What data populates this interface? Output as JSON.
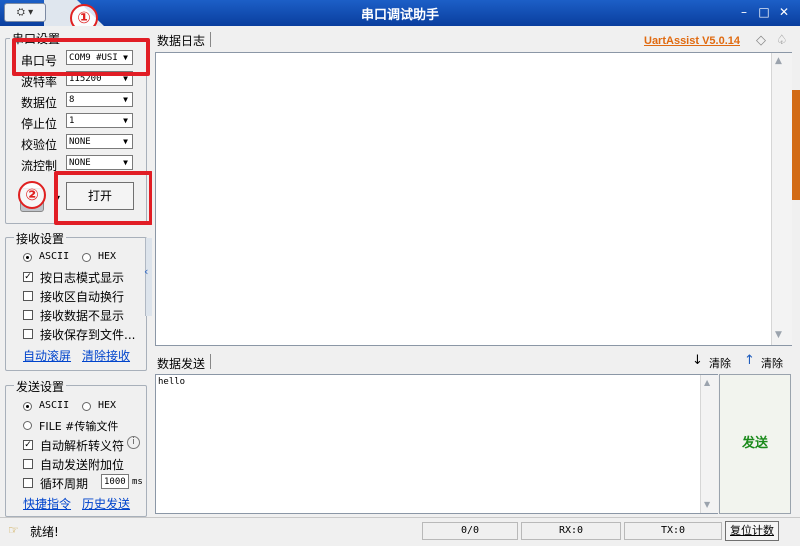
{
  "window": {
    "title": "串口调试助手",
    "version_label": "UartAssist V5.0.14"
  },
  "annotations": {
    "step1": "①",
    "step2": "②"
  },
  "serial": {
    "group_title": "串口设置",
    "port_label": "串口号",
    "port_value": "COM9 #USI",
    "baud_label": "波特率",
    "baud_value": "115200",
    "databits_label": "数据位",
    "databits_value": "8",
    "stopbits_label": "停止位",
    "stopbits_value": "1",
    "parity_label": "校验位",
    "parity_value": "NONE",
    "flow_label": "流控制",
    "flow_value": "NONE",
    "open_button": "打开"
  },
  "receive": {
    "group_title": "接收设置",
    "ascii": "ASCII",
    "hex": "HEX",
    "opt_log_mode": "按日志模式显示",
    "opt_auto_wrap": "接收区自动换行",
    "opt_no_display": "接收数据不显示",
    "opt_save_file": "接收保存到文件...",
    "link_auto_scroll": "自动滚屏",
    "link_clear_recv": "清除接收"
  },
  "send": {
    "group_title": "发送设置",
    "ascii": "ASCII",
    "hex": "HEX",
    "opt_file_source": "FILE #传输文件",
    "opt_escape": "自动解析转义符",
    "opt_append_check": "自动发送附加位",
    "opt_cycle": "循环周期",
    "cycle_value": "1000",
    "cycle_unit": "ms",
    "link_shortcut": "快捷指令",
    "link_history": "历史发送"
  },
  "log_panel": {
    "tab": "数据日志"
  },
  "send_panel": {
    "tab": "数据发送",
    "clear1": "清除",
    "clear2": "清除",
    "content": "hello",
    "send_button": "发送"
  },
  "status": {
    "ready": "就绪!",
    "counter": "0/0",
    "rx": "RX:0",
    "tx": "TX:0",
    "reset": "复位计数"
  }
}
